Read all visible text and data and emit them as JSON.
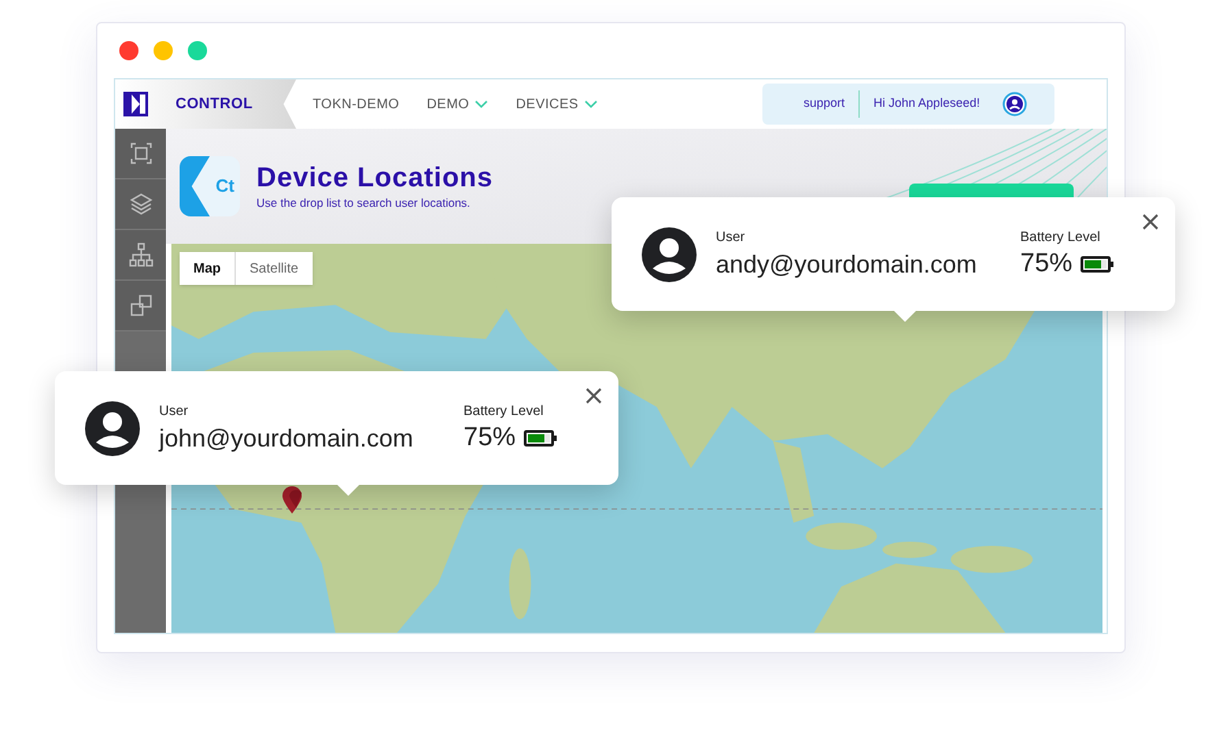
{
  "nav": {
    "brand": "CONTROL",
    "items": [
      {
        "label": "TOKN-DEMO",
        "dropdown": false
      },
      {
        "label": "DEMO",
        "dropdown": true
      },
      {
        "label": "DEVICES",
        "dropdown": true
      }
    ],
    "support": "support",
    "greeting": "Hi John Appleseed!"
  },
  "header": {
    "logo": "Ct",
    "title": "Device Locations",
    "subtitle": "Use the drop list to search user locations."
  },
  "map": {
    "tabs": [
      {
        "label": "Map",
        "selected": true
      },
      {
        "label": "Satellite",
        "selected": false
      }
    ]
  },
  "popups": [
    {
      "user_label": "User",
      "user": "andy@yourdomain.com",
      "battery_label": "Battery Level",
      "battery": "75%",
      "level": 0.75
    },
    {
      "user_label": "User",
      "user": "john@yourdomain.com",
      "battery_label": "Battery Level",
      "battery": "75%",
      "level": 0.75
    }
  ]
}
